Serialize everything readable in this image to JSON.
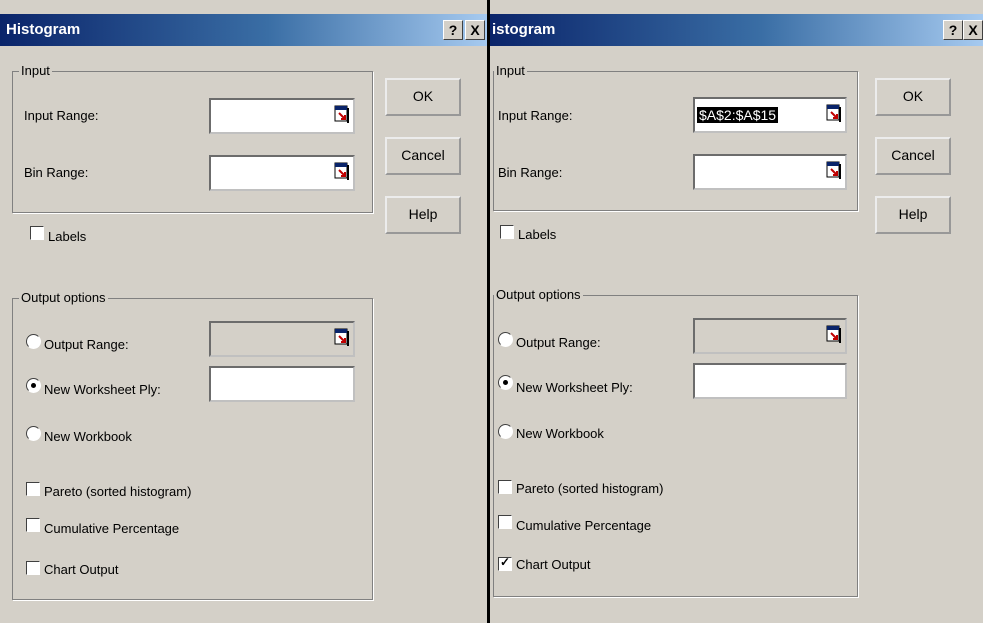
{
  "left_dialog": {
    "title": "Histogram",
    "help_glyph": "?",
    "close_glyph": "X",
    "input_group_label": "Input",
    "input_range_label": "Input Range:",
    "input_range_value": "",
    "bin_range_label": "Bin Range:",
    "bin_range_value": "",
    "labels_label": "Labels",
    "labels_checked": false,
    "output_group_label": "Output options",
    "output_range_label": "Output Range:",
    "new_worksheet_label": "New Worksheet Ply:",
    "new_worksheet_value": "",
    "new_workbook_label": "New Workbook",
    "selected_output": "new-worksheet-ply",
    "pareto_label": "Pareto (sorted histogram)",
    "pareto_checked": false,
    "cumulative_label": "Cumulative Percentage",
    "cumulative_checked": false,
    "chart_output_label": "Chart Output",
    "chart_output_checked": false,
    "ok_label": "OK",
    "cancel_label": "Cancel",
    "help_label": "Help"
  },
  "right_dialog": {
    "title": "istogram",
    "help_glyph": "?",
    "close_glyph": "X",
    "input_group_label": "Input",
    "input_range_label": "Input Range:",
    "input_range_value": "$A$2:$A$15",
    "bin_range_label": "Bin Range:",
    "bin_range_value": "",
    "labels_label": "Labels",
    "labels_checked": false,
    "output_group_label": "Output options",
    "output_range_label": "Output Range:",
    "new_worksheet_label": "New Worksheet Ply:",
    "new_worksheet_value": "",
    "new_workbook_label": "New Workbook",
    "selected_output": "new-worksheet-ply",
    "pareto_label": "Pareto (sorted histogram)",
    "pareto_checked": false,
    "cumulative_label": "Cumulative Percentage",
    "cumulative_checked": false,
    "chart_output_label": "Chart Output",
    "chart_output_checked": true,
    "ok_label": "OK",
    "cancel_label": "Cancel",
    "help_label": "Help"
  },
  "colors": {
    "title_bar_start": "#0a246a",
    "title_bar_end": "#a6caf0",
    "dialog_face": "#d4d0c8",
    "selection_highlight": "#000000"
  }
}
